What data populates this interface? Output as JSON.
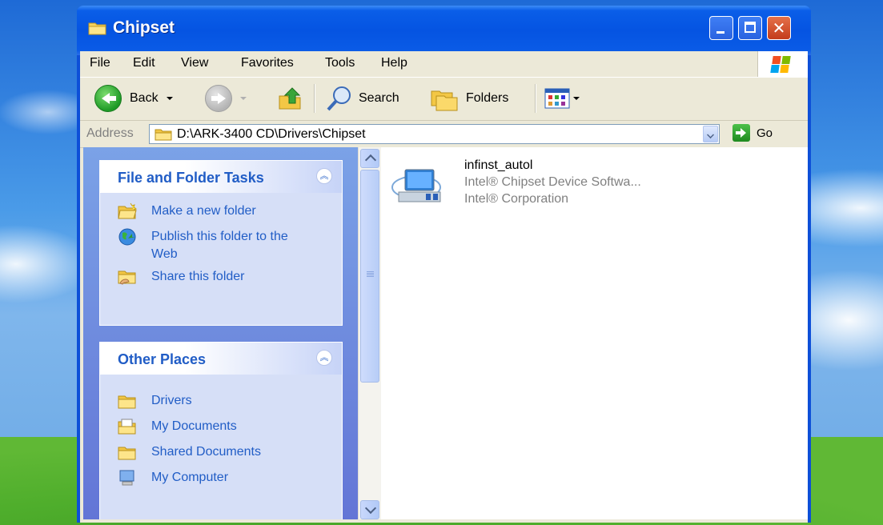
{
  "window": {
    "title": "Chipset"
  },
  "menu": [
    "File",
    "Edit",
    "View",
    "Favorites",
    "Tools",
    "Help"
  ],
  "toolbar": {
    "back": "Back",
    "search": "Search",
    "folders": "Folders"
  },
  "address": {
    "label": "Address",
    "path": "D:\\ARK-3400 CD\\Drivers\\Chipset",
    "go": "Go"
  },
  "taskpane": {
    "file_tasks": {
      "title": "File and Folder Tasks",
      "items": [
        {
          "label": "Make a new folder",
          "icon": "new-folder-icon"
        },
        {
          "label": "Publish this folder to the Web",
          "icon": "globe-icon"
        },
        {
          "label": "Share this folder",
          "icon": "share-folder-icon"
        }
      ]
    },
    "other_places": {
      "title": "Other Places",
      "items": [
        {
          "label": "Drivers",
          "icon": "folder-icon"
        },
        {
          "label": "My Documents",
          "icon": "documents-icon"
        },
        {
          "label": "Shared Documents",
          "icon": "folder-icon"
        },
        {
          "label": "My Computer",
          "icon": "computer-icon"
        }
      ]
    }
  },
  "files": [
    {
      "name": "infinst_autol",
      "description": "Intel® Chipset Device Softwa...",
      "company": "Intel® Corporation",
      "icon": "installer-icon"
    }
  ],
  "colors": {
    "title_bar": "#0554e2",
    "task_link": "#215dc6",
    "close_button": "#c33c1b"
  }
}
